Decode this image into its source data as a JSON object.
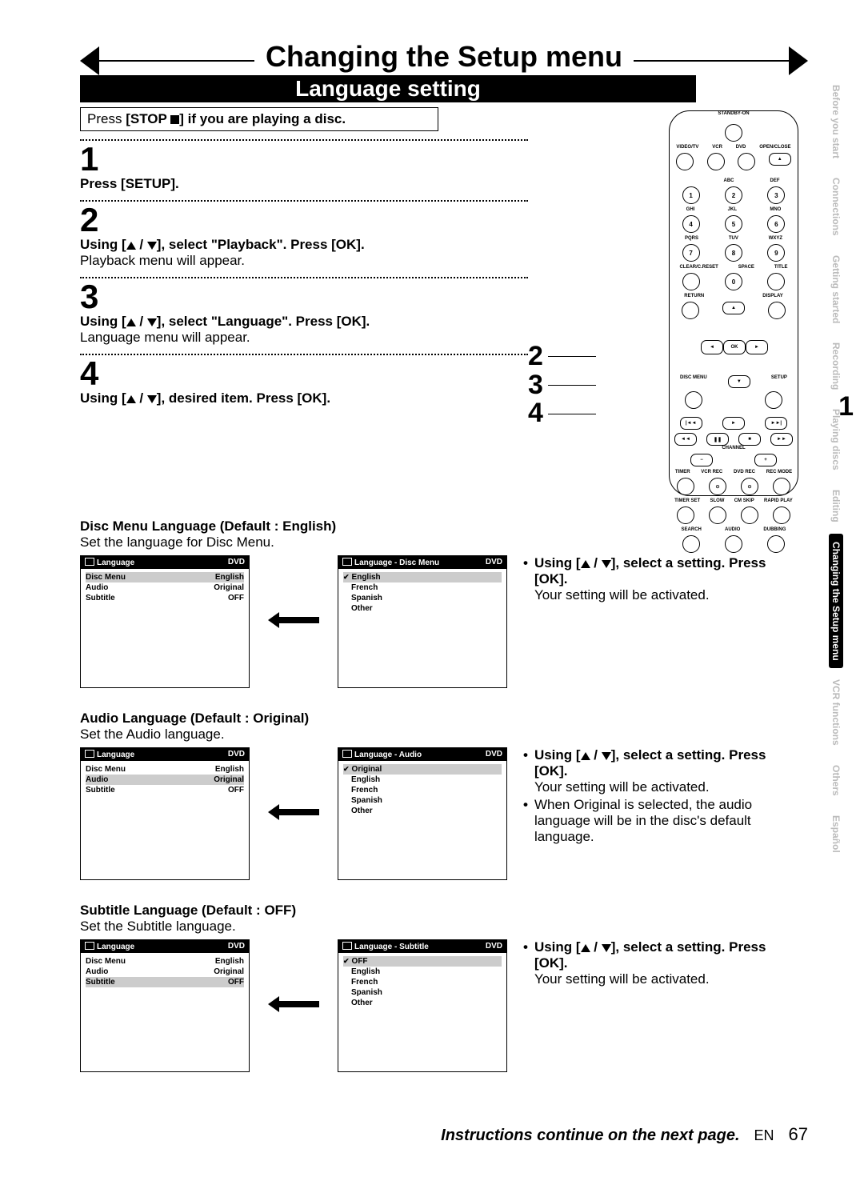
{
  "title": "Changing the Setup menu",
  "section": "Language setting",
  "press_stop": {
    "pre": "Press  ",
    "btn": "[STOP ",
    "post": "] if you are playing a disc."
  },
  "steps": [
    {
      "n": "1",
      "bold": "Press [SETUP].",
      "text": ""
    },
    {
      "n": "2",
      "bold": "Using [▲ / ▼], select \"Playback\". Press [OK].",
      "text": "Playback menu will appear."
    },
    {
      "n": "3",
      "bold": "Using [▲ / ▼], select \"Language\". Press [OK].",
      "text": "Language menu will appear."
    },
    {
      "n": "4",
      "bold": "Using [▲ / ▼], desired item. Press [OK].",
      "text": ""
    }
  ],
  "remote_callouts_left": [
    "2",
    "3",
    "4"
  ],
  "remote_callout_right": "1",
  "remote_labels": {
    "standby": "STANDBY-ON",
    "row1": [
      "VIDEO/TV",
      "VCR",
      "DVD",
      "OPEN/CLOSE"
    ],
    "eject": "▲",
    "numrow1_lbl": [
      "",
      "ABC",
      "DEF"
    ],
    "numrow1": [
      "1",
      "2",
      "3"
    ],
    "numrow2_lbl": [
      "GHI",
      "JKL",
      "MNO"
    ],
    "numrow2": [
      "4",
      "5",
      "6"
    ],
    "numrow3_lbl": [
      "PQRS",
      "TUV",
      "WXYZ"
    ],
    "numrow3": [
      "7",
      "8",
      "9"
    ],
    "numrow4_lbl": [
      "CLEAR/C.RESET",
      "SPACE",
      "TITLE"
    ],
    "numrow4": [
      "",
      "0",
      ""
    ],
    "return": "RETURN",
    "display": "DISPLAY",
    "ok": "OK",
    "discmenu": "DISC MENU",
    "setup": "SETUP",
    "channel": "CHANNEL",
    "chm": "−",
    "chp": "+",
    "rec_lbl": [
      "TIMER",
      "VCR REC",
      "DVD REC",
      "REC MODE"
    ],
    "rec2_lbl": [
      "TIMER SET",
      "SLOW",
      "CM SKIP",
      "RAPID PLAY"
    ],
    "rec3_lbl": [
      "SEARCH",
      "AUDIO",
      "DUBBING"
    ]
  },
  "groups": [
    {
      "head": "Disc Menu Language (Default : English)",
      "desc": "Set the language for Disc Menu.",
      "left": {
        "title": "Language",
        "badge": "DVD",
        "rows": [
          [
            "Disc Menu",
            "English"
          ],
          [
            "Audio",
            "Original"
          ],
          [
            "Subtitle",
            "OFF"
          ]
        ],
        "sel": 0
      },
      "right": {
        "title": "Language - Disc Menu",
        "badge": "DVD",
        "items": [
          "English",
          "French",
          "Spanish",
          "Other"
        ],
        "sel": 0,
        "chk": 0
      },
      "bullets": [
        {
          "bold": "Using [▲ / ▼], select a setting. Press [OK].",
          "text": "Your setting will be activated."
        }
      ]
    },
    {
      "head": "Audio Language (Default : Original)",
      "desc": "Set the Audio language.",
      "left": {
        "title": "Language",
        "badge": "DVD",
        "rows": [
          [
            "Disc Menu",
            "English"
          ],
          [
            "Audio",
            "Original"
          ],
          [
            "Subtitle",
            "OFF"
          ]
        ],
        "sel": 1
      },
      "right": {
        "title": "Language - Audio",
        "badge": "DVD",
        "items": [
          "Original",
          "English",
          "French",
          "Spanish",
          "Other"
        ],
        "sel": 0,
        "chk": 0
      },
      "bullets": [
        {
          "bold": "Using [▲ / ▼], select a setting. Press [OK].",
          "text": "Your setting will be activated."
        },
        {
          "bold": "",
          "text": "When Original is selected, the audio language will be in the disc's default language."
        }
      ]
    },
    {
      "head": "Subtitle Language (Default : OFF)",
      "desc": "Set the Subtitle language.",
      "left": {
        "title": "Language",
        "badge": "DVD",
        "rows": [
          [
            "Disc Menu",
            "English"
          ],
          [
            "Audio",
            "Original"
          ],
          [
            "Subtitle",
            "OFF"
          ]
        ],
        "sel": 2
      },
      "right": {
        "title": "Language - Subtitle",
        "badge": "DVD",
        "items": [
          "OFF",
          "English",
          "French",
          "Spanish",
          "Other"
        ],
        "sel": 0,
        "chk": 0
      },
      "bullets": [
        {
          "bold": "Using [▲ / ▼], select a setting. Press [OK].",
          "text": "Your setting will be activated."
        }
      ]
    }
  ],
  "tabs": [
    "Before you start",
    "Connections",
    "Getting started",
    "Recording",
    "Playing discs",
    "Editing",
    "Changing the Setup menu",
    "VCR functions",
    "Others",
    "Español"
  ],
  "tab_active": 6,
  "footer": {
    "cont": "Instructions continue on the next page.",
    "en": "EN",
    "page": "67"
  }
}
